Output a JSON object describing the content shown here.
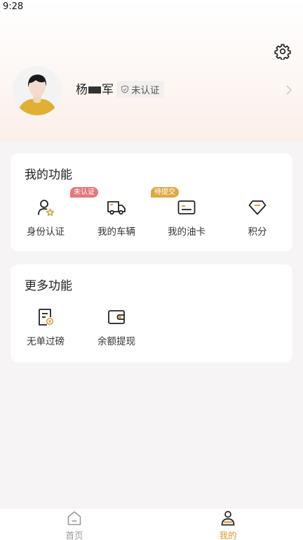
{
  "status_bar": {
    "time": "9:28"
  },
  "profile": {
    "name_first": "杨",
    "name_last": "军",
    "verify_status": "未认证"
  },
  "my_functions": {
    "title": "我的功能",
    "items": [
      {
        "label": "身份认证",
        "icon": "person-star-icon",
        "tag": "未认证",
        "tag_color": "#e5787b"
      },
      {
        "label": "我的车辆",
        "icon": "truck-icon",
        "tag": "待提交",
        "tag_color": "#dfa846"
      },
      {
        "label": "我的油卡",
        "icon": "card-icon"
      },
      {
        "label": "积分",
        "icon": "diamond-icon"
      }
    ]
  },
  "more_functions": {
    "title": "更多功能",
    "items": [
      {
        "label": "无单过磅",
        "icon": "receipt-icon"
      },
      {
        "label": "余额提现",
        "icon": "wallet-icon"
      }
    ]
  },
  "tabbar": {
    "tabs": [
      {
        "label": "首页",
        "icon": "home-icon",
        "active": false
      },
      {
        "label": "我的",
        "icon": "user-icon",
        "active": true
      }
    ],
    "active_color": "#d69b2e",
    "inactive_color": "#999999"
  }
}
